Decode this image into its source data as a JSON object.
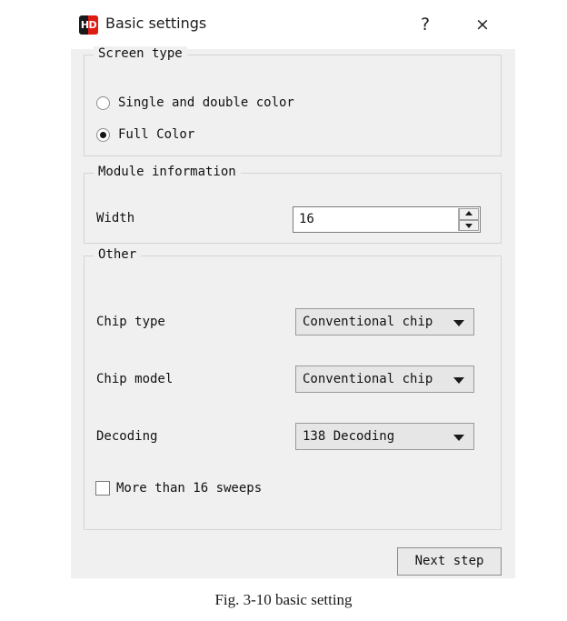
{
  "dialog": {
    "title": "Basic settings",
    "icon_name": "hd-logo-icon",
    "icon_text": "HD",
    "help_glyph": "?",
    "close_glyph": "×",
    "accent_color": "#e01b12",
    "body_color": "#f0f0f0",
    "titlebar_color": "#ffffff"
  },
  "screen_type": {
    "group_title": "Screen type",
    "options": [
      {
        "label": "Single and double color",
        "checked": false
      },
      {
        "label": "Full Color",
        "checked": true
      }
    ]
  },
  "module_information": {
    "group_title": "Module information",
    "width_label": "Width",
    "width_value": "16",
    "width_placeholder": "16"
  },
  "other": {
    "group_title": "Other",
    "fields": [
      {
        "label": "Chip type",
        "value": "Conventional chip"
      },
      {
        "label": "Chip model",
        "value": "Conventional chip"
      },
      {
        "label": "Decoding",
        "value": "138 Decoding"
      }
    ],
    "checkbox": {
      "label": "More than 16 sweeps",
      "checked": false
    }
  },
  "footer": {
    "next_step_label": "Next step"
  },
  "caption": {
    "text": "Fig. 3-10 basic setting"
  }
}
